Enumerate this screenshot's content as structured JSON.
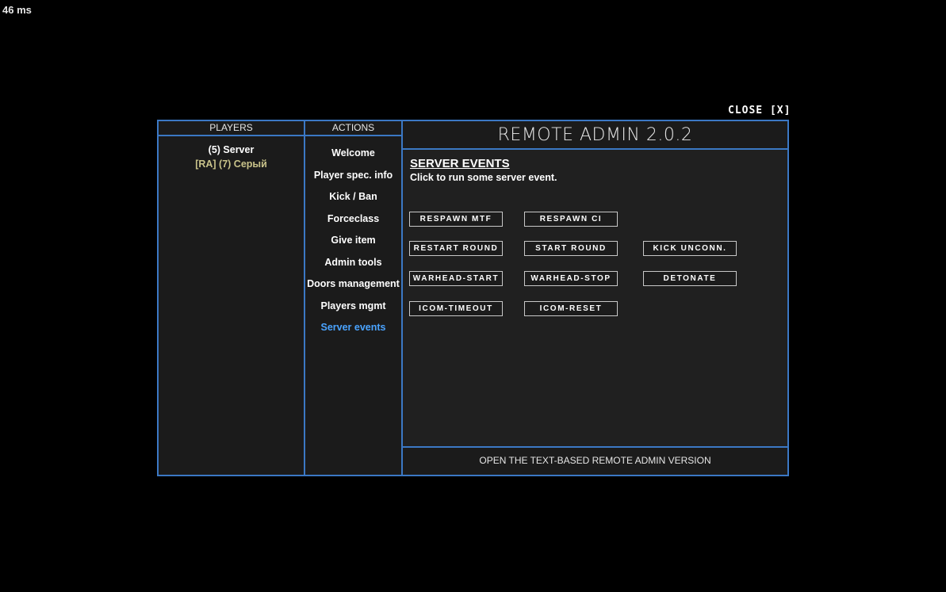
{
  "status": {
    "ping": "46 ms"
  },
  "close_label": "CLOSE [X]",
  "players": {
    "header": "PLAYERS",
    "items": [
      {
        "label": "(5) Server"
      },
      {
        "label": "[RA] (7) Серый"
      }
    ]
  },
  "actions": {
    "header": "ACTIONS",
    "items": [
      {
        "label": "Welcome"
      },
      {
        "label": "Player spec. info"
      },
      {
        "label": "Kick / Ban"
      },
      {
        "label": "Forceclass"
      },
      {
        "label": "Give item"
      },
      {
        "label": "Admin tools"
      },
      {
        "label": "Doors management"
      },
      {
        "label": "Players mgmt"
      },
      {
        "label": "Server events"
      }
    ],
    "active": "Server events"
  },
  "main": {
    "title": "REMOTE ADMIN 2.0.2",
    "section_title": "SERVER EVENTS",
    "section_subtitle": "Click to run some server event.",
    "buttons": {
      "respawn_mtf": "RESPAWN MTF",
      "respawn_ci": "RESPAWN CI",
      "restart_round": "RESTART ROUND",
      "start_round": "START ROUND",
      "kick_unconn": "KICK UNCONN.",
      "warhead_start": "WARHEAD-START",
      "warhead_stop": "WARHEAD-STOP",
      "detonate": "DETONATE",
      "icom_timeout": "ICOM-TIMEOUT",
      "icom_reset": "ICOM-RESET"
    },
    "footer": "OPEN THE TEXT-BASED REMOTE ADMIN VERSION"
  },
  "colors": {
    "accent_border": "#3b78c4",
    "active_action": "#4aa3ff",
    "ra_player": "#c9c38a"
  }
}
